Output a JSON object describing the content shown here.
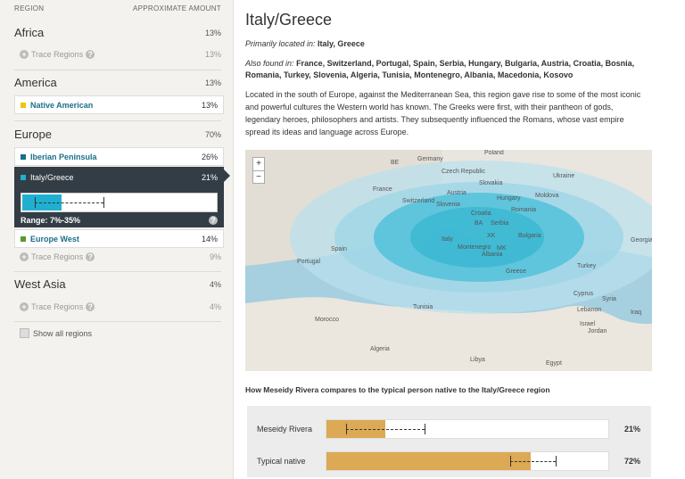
{
  "sidebar": {
    "header_region": "REGION",
    "header_amount": "APPROXIMATE AMOUNT",
    "africa": {
      "name": "Africa",
      "pct": "13%",
      "trace": "Trace Regions",
      "trace_pct": "13%"
    },
    "america": {
      "name": "America",
      "pct": "13%",
      "sub": {
        "name": "Native American",
        "pct": "13%",
        "color": "#f2c500"
      }
    },
    "europe": {
      "name": "Europe",
      "pct": "70%",
      "iberian": {
        "name": "Iberian Peninsula",
        "pct": "26%",
        "color": "#1a6f8a"
      },
      "italy": {
        "name": "Italy/Greece",
        "pct": "21%",
        "range": "Range: 7%-35%",
        "color": "#1fb0d1"
      },
      "west": {
        "name": "Europe West",
        "pct": "14%",
        "color": "#5a9a2a"
      },
      "trace": "Trace Regions",
      "trace_pct": "9%"
    },
    "westasia": {
      "name": "West Asia",
      "pct": "4%",
      "trace": "Trace Regions",
      "trace_pct": "4%"
    },
    "show_all": "Show all regions"
  },
  "main": {
    "title": "Italy/Greece",
    "primary_label": "Primarily located in:",
    "primary": "Italy, Greece",
    "also_label": "Also found in:",
    "also_line1": "France, Switzerland, Portugal, Spain, Serbia, Hungary, Bulgaria, Austria, Croatia, Bosnia,",
    "also_line2": "Romania, Turkey, Slovenia, Algeria, Tunisia, Montenegro, Albania, Macedonia, Kosovo",
    "description": "Located in the south of Europe, against the Mediterranean Sea, this region gave rise to some of the most iconic and powerful cultures the Western world has known. The Greeks were first, with their pantheon of gods, legendary heroes, philosophers and artists. They subsequently influenced the Romans, whose vast empire spread its ideas and language across Europe."
  },
  "map": {
    "zoom_in": "+",
    "zoom_out": "−",
    "labels": [
      "Poland",
      "Germany",
      "BE",
      "Czech Republic",
      "Slovakia",
      "Ukraine",
      "France",
      "Austria",
      "Hungary",
      "Moldova",
      "Switzerland",
      "Slovenia",
      "Croatia",
      "Romania",
      "BA",
      "Serbia",
      "Italy",
      "Montenegro",
      "XK",
      "Bulgaria",
      "MK",
      "Albania",
      "Portugal",
      "Spain",
      "Greece",
      "Turkey",
      "Tunisia",
      "Cyprus",
      "Syria",
      "Lebanon",
      "Iraq",
      "Israel",
      "Jordan",
      "Morocco",
      "Algeria",
      "Libya",
      "Egypt",
      "Georgia"
    ]
  },
  "compare": {
    "title": "How Meseidy Rivera compares to the typical person native to the Italy/Greece region",
    "rows": [
      {
        "label": "Meseidy Rivera",
        "value": "21%"
      },
      {
        "label": "Typical native",
        "value": "72%"
      }
    ]
  }
}
